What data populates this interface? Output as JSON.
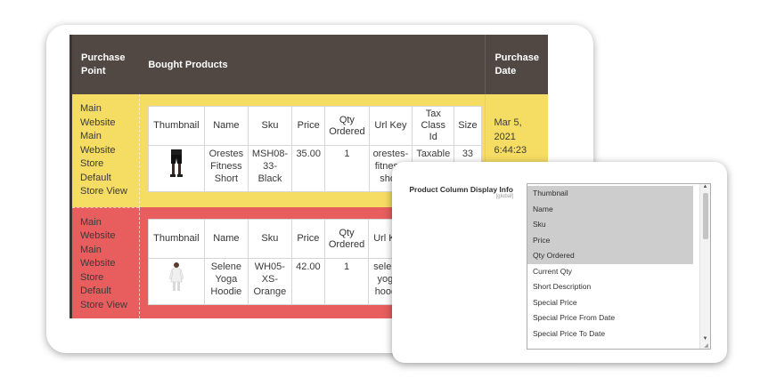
{
  "headers": {
    "purchase_point": "Purchase Point",
    "bought_products": "Bought Products",
    "purchase_date": "Purchase Date"
  },
  "inner_headers": [
    "Thumbnail",
    "Name",
    "Sku",
    "Price",
    "Qty Ordered",
    "Url Key",
    "Tax Class Id",
    "Size"
  ],
  "rows": [
    {
      "point": [
        "Main Website",
        "Main Website Store",
        "Default Store View"
      ],
      "date": "Mar 5, 2021 6:44:23",
      "color": "#f5dc62",
      "product": {
        "name": "Orestes Fitness Short",
        "sku": "MSH08-33-Black",
        "price": "35.00",
        "qty": "1",
        "url_key": "orestes-fitness-short",
        "tax_class": "Taxable",
        "size": "33"
      }
    },
    {
      "point": [
        "Main Website",
        "Main Website Store",
        "Default Store View"
      ],
      "date": "",
      "color": "#e85e5e",
      "product": {
        "name": "Selene Yoga Hoodie",
        "sku": "WH05-XS-Orange",
        "price": "42.00",
        "qty": "1",
        "url_key": "selene-yoga-hoodie",
        "tax_class": "",
        "size": ""
      }
    }
  ],
  "config": {
    "label": "Product Column Display Info",
    "scope": "[global]",
    "options": [
      {
        "label": "Thumbnail",
        "selected": true
      },
      {
        "label": "Name",
        "selected": true
      },
      {
        "label": "Sku",
        "selected": true
      },
      {
        "label": "Price",
        "selected": true
      },
      {
        "label": "Qty Ordered",
        "selected": true
      },
      {
        "label": "Current Qty",
        "selected": false
      },
      {
        "label": "Short Description",
        "selected": false
      },
      {
        "label": "Special Price",
        "selected": false
      },
      {
        "label": "Special Price From Date",
        "selected": false
      },
      {
        "label": "Special Price To Date",
        "selected": false
      }
    ]
  },
  "colors": {
    "header_bg": "#514843",
    "row_yellow": "#f5dc62",
    "row_red": "#e85e5e",
    "option_selected": "#cdcdcd"
  },
  "icons": {
    "scroll_up": "scroll-up-arrow-icon",
    "scroll_down": "scroll-down-arrow-icon",
    "thumb_shorts": "shorts-thumbnail",
    "thumb_hoodie": "hoodie-thumbnail"
  }
}
